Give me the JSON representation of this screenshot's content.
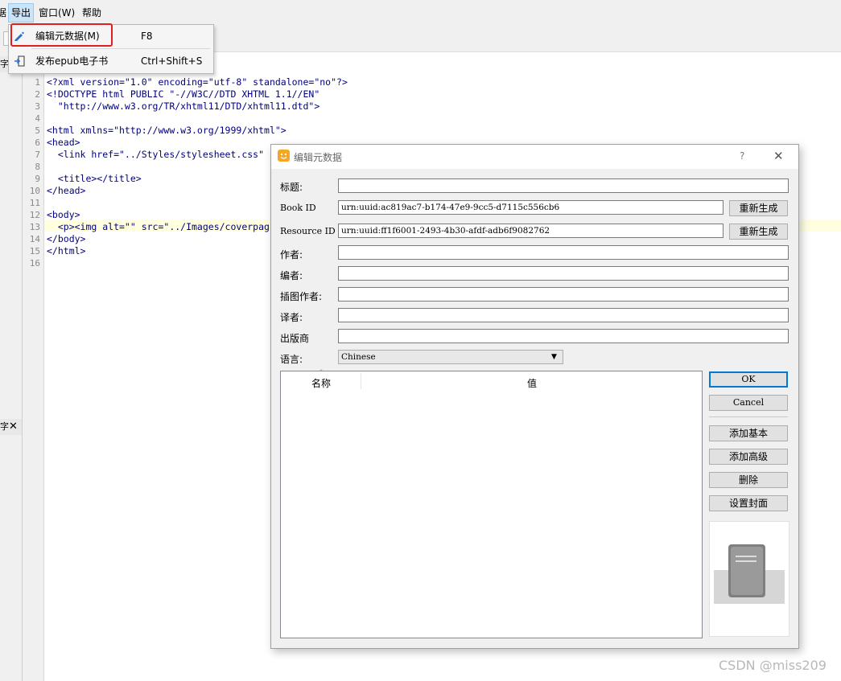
{
  "menubar": {
    "partial_left": "据",
    "export": "导出",
    "window": "窗口(W)",
    "help": "帮助"
  },
  "export_menu": {
    "items": [
      {
        "label": "编辑元数据(M)",
        "shortcut": "F8"
      },
      {
        "label": "发布epub电子书",
        "shortcut": "Ctrl+Shift+S"
      }
    ]
  },
  "left_panel": {
    "dock1": "字",
    "dock2": "字"
  },
  "editor": {
    "line_numbers": [
      "1",
      "2",
      "3",
      "4",
      "5",
      "6",
      "7",
      "8",
      "9",
      "10",
      "11",
      "12",
      "13",
      "14",
      "15",
      "16"
    ],
    "lines": [
      "<?xml version=\"1.0\" encoding=\"utf-8\" standalone=\"no\"?>",
      "<!DOCTYPE html PUBLIC \"-//W3C//DTD XHTML 1.1//EN\"",
      "  \"http://www.w3.org/TR/xhtml11/DTD/xhtml11.dtd\">",
      "",
      "<html xmlns=\"http://www.w3.org/1999/xhtml\">",
      "<head>",
      "  <link href=\"../Styles/stylesheet.css\"",
      "",
      "  <title></title>",
      "</head>",
      "",
      "<body>",
      "  <p><img alt=\"\" src=\"../Images/coverpag",
      "</body>",
      "</html>",
      ""
    ]
  },
  "dialog": {
    "title": "编辑元数据",
    "help": "?",
    "close": "✕",
    "labels": {
      "title": "标题:",
      "book_id": "Book ID",
      "resource_id": "Resource ID",
      "author": "作者:",
      "editor": "编者:",
      "illustrator": "插图作者:",
      "translator": "译者:",
      "publisher": "出版商",
      "language": "语言:"
    },
    "values": {
      "title": "",
      "book_id": "urn:uuid:ac819ac7-b174-47e9-9cc5-d7115c556cb6",
      "resource_id": "urn:uuid:ff1f6001-2493-4b30-afdf-adb6f9082762",
      "author": "",
      "editor": "",
      "illustrator": "",
      "translator": "",
      "publisher": "",
      "language": "Chinese"
    },
    "regenerate_label": "重新生成",
    "table_headers": {
      "name": "名称",
      "value": "值"
    },
    "buttons": {
      "ok": "OK",
      "cancel": "Cancel",
      "add_basic": "添加基本",
      "add_advanced": "添加高级",
      "delete": "删除",
      "set_cover": "设置封面"
    }
  },
  "watermark": "CSDN @miss209"
}
